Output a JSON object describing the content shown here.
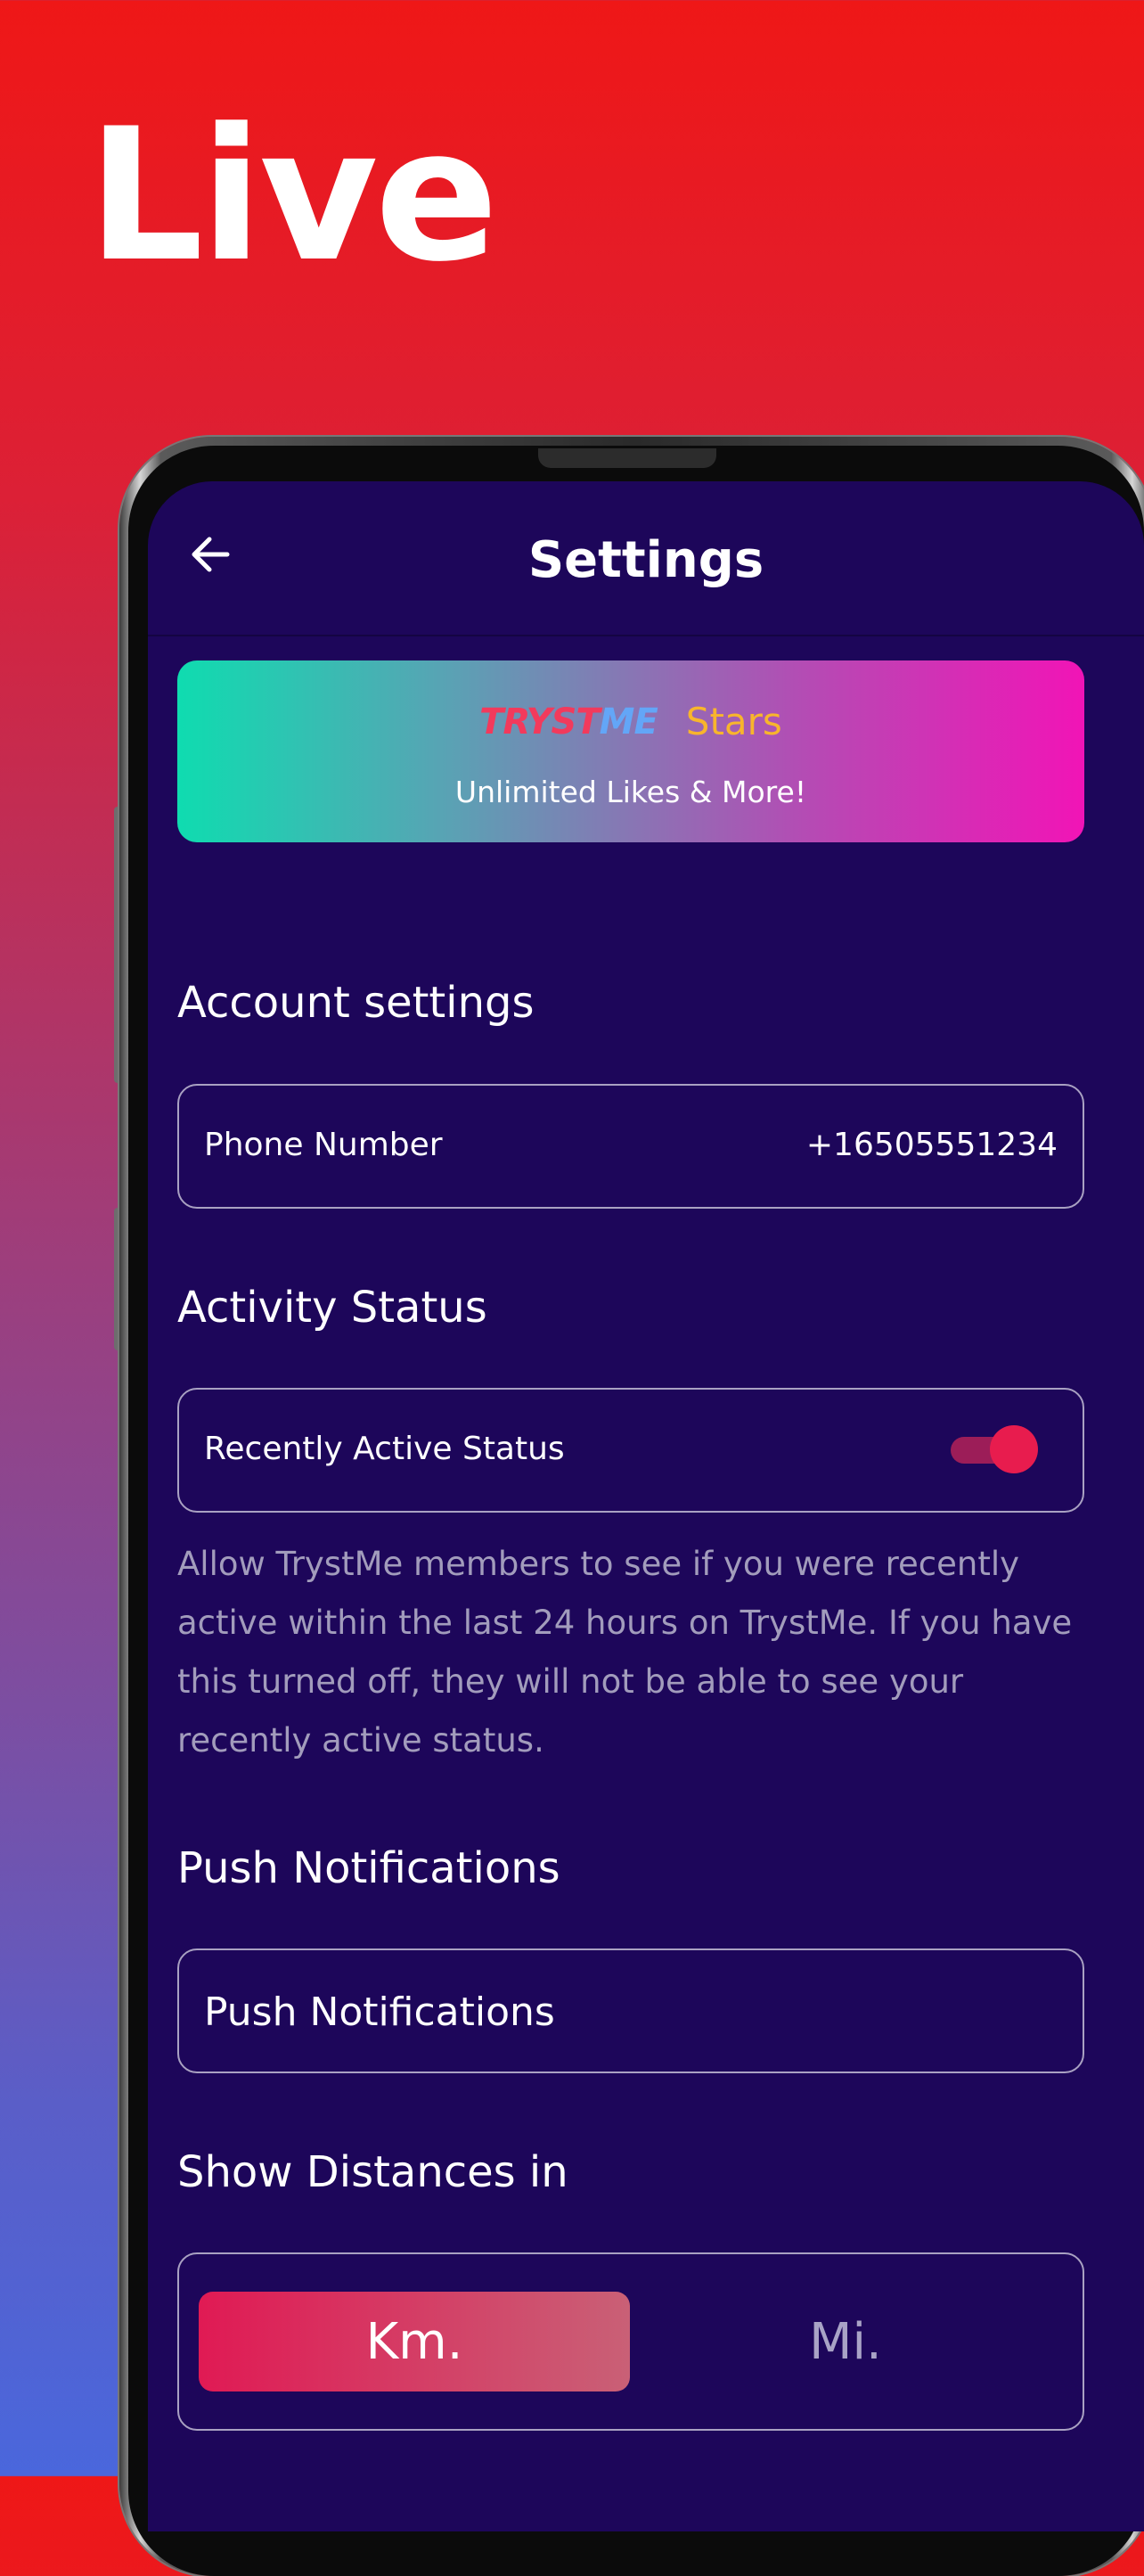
{
  "promo": {
    "headline": "Live"
  },
  "header": {
    "title": "Settings"
  },
  "banner": {
    "brand_part_1": "TRYST",
    "brand_part_2": "ME",
    "tier": "Stars",
    "subtitle": "Unlimited Likes & More!"
  },
  "account": {
    "section_title": "Account settings",
    "phone_label": "Phone Number",
    "phone_value": "+16505551234"
  },
  "activity": {
    "section_title": "Activity Status",
    "toggle_label": "Recently Active Status",
    "toggle_on": true,
    "description": "Allow TrystMe members to see if you were recently active within the last 24 hours on TrystMe. If you have this turned off, they will not be able to see your recently active status."
  },
  "push": {
    "section_title": "Push Notifications",
    "item_label": "Push Notifications"
  },
  "distance": {
    "section_title": "Show Distances in",
    "options": [
      "Km.",
      "Mi."
    ],
    "selected": "Km."
  },
  "colors": {
    "screen_background": "#1d065a",
    "accent": "#e81c4e",
    "stars": "#f8b52c"
  }
}
